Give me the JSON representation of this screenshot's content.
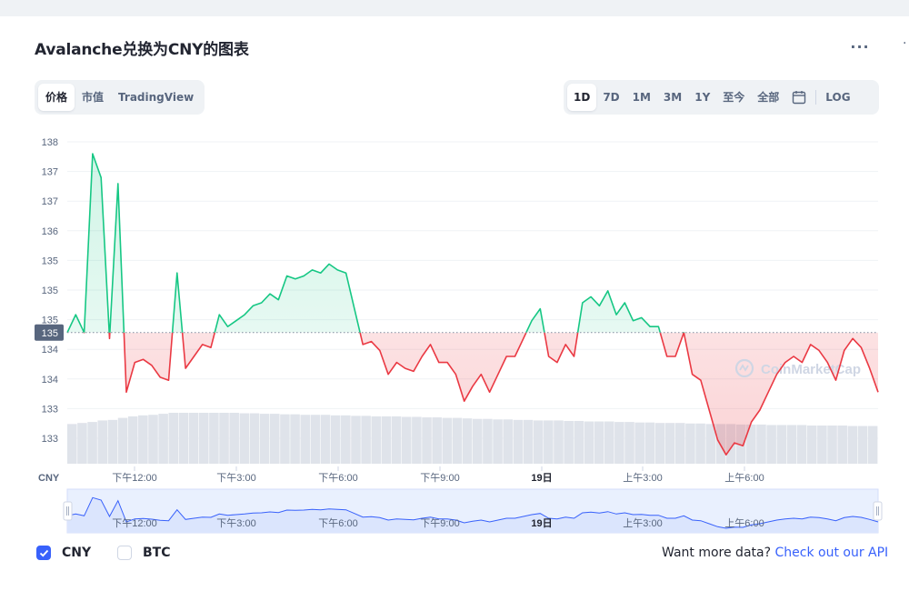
{
  "title": "Avalanche兑换为CNY的图表",
  "menu_icon": "ellipsis-icon",
  "menu_glyph": "···",
  "view_tabs": [
    {
      "label": "价格",
      "active": true
    },
    {
      "label": "市值",
      "active": false
    },
    {
      "label": "TradingView",
      "active": false
    }
  ],
  "range_tabs": [
    {
      "label": "1D",
      "active": true
    },
    {
      "label": "7D",
      "active": false
    },
    {
      "label": "1M",
      "active": false
    },
    {
      "label": "3M",
      "active": false
    },
    {
      "label": "1Y",
      "active": false
    },
    {
      "label": "至今",
      "active": false
    },
    {
      "label": "全部",
      "active": false
    }
  ],
  "calendar_icon": "calendar-icon",
  "log_label": "LOG",
  "watermark": "CoinMarketCap",
  "colors": {
    "up": "#16c784",
    "down": "#ea3943",
    "accent": "#3861fb",
    "grid": "#eff2f5",
    "text_muted": "#58667e"
  },
  "chart_data": {
    "type": "line",
    "currency_label": "CNY",
    "y_ticks": [
      "138",
      "137",
      "137",
      "136",
      "135",
      "135",
      "135",
      "134",
      "134",
      "133",
      "133"
    ],
    "y_range": [
      132.8,
      138.2
    ],
    "reference_value": 135.0,
    "reference_label": "135",
    "x_ticks": [
      "下午12:00",
      "下午3:00",
      "下午6:00",
      "下午9:00",
      "19日",
      "上午3:00",
      "上午6:00"
    ],
    "x_tick_bold": [
      false,
      false,
      false,
      false,
      true,
      false,
      false
    ],
    "series": [
      {
        "values": [
          135.0,
          135.3,
          135.0,
          138.0,
          137.6,
          134.9,
          137.5,
          134.0,
          134.5,
          134.55,
          134.45,
          134.25,
          134.2,
          136.0,
          134.4,
          134.6,
          134.8,
          134.75,
          135.3,
          135.1,
          135.2,
          135.3,
          135.45,
          135.5,
          135.65,
          135.55,
          135.95,
          135.9,
          135.95,
          136.05,
          136.0,
          136.15,
          136.05,
          136.0,
          135.4,
          134.8,
          134.85,
          134.7,
          134.3,
          134.5,
          134.4,
          134.35,
          134.6,
          134.8,
          134.5,
          134.5,
          134.3,
          133.85,
          134.1,
          134.3,
          134.0,
          134.3,
          134.6,
          134.6,
          134.9,
          135.2,
          135.4,
          134.6,
          134.5,
          134.8,
          134.6,
          135.5,
          135.6,
          135.45,
          135.7,
          135.3,
          135.5,
          135.2,
          135.25,
          135.1,
          135.1,
          134.6,
          134.6,
          135.0,
          134.3,
          134.2,
          133.7,
          133.2,
          132.95,
          133.15,
          133.1,
          133.5,
          133.7,
          134.0,
          134.3,
          134.5,
          134.6,
          134.5,
          134.8,
          134.7,
          134.5,
          134.2,
          134.7,
          134.9,
          134.75,
          134.4,
          134.0
        ]
      }
    ],
    "volume_bar_fraction": [
      0.78,
      0.8,
      0.82,
      0.85,
      0.86,
      0.9,
      0.93,
      0.95,
      0.96,
      0.98,
      1.0,
      1.0,
      1.0,
      1.0,
      1.0,
      1.0,
      1.0,
      0.99,
      0.99,
      0.98,
      0.98,
      0.97,
      0.97,
      0.96,
      0.96,
      0.96,
      0.95,
      0.95,
      0.94,
      0.94,
      0.93,
      0.93,
      0.93,
      0.92,
      0.92,
      0.91,
      0.91,
      0.9,
      0.9,
      0.89,
      0.88,
      0.88,
      0.87,
      0.87,
      0.86,
      0.86,
      0.85,
      0.85,
      0.85,
      0.84,
      0.84,
      0.83,
      0.83,
      0.83,
      0.82,
      0.82,
      0.81,
      0.81,
      0.8,
      0.8,
      0.8,
      0.79,
      0.79,
      0.78,
      0.78,
      0.78,
      0.77,
      0.77,
      0.77,
      0.76,
      0.76,
      0.76,
      0.76,
      0.75,
      0.75,
      0.75,
      0.75,
      0.74,
      0.74,
      0.74
    ]
  },
  "legend": [
    {
      "label": "CNY",
      "checked": true,
      "check_icon": "checkmark-icon"
    },
    {
      "label": "BTC",
      "checked": false
    }
  ],
  "footer": {
    "prompt": "Want more data?",
    "link": "Check out our API"
  }
}
